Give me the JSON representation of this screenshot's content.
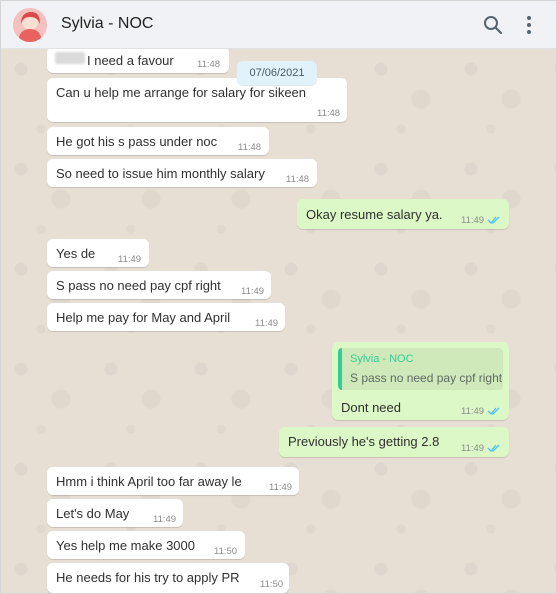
{
  "header": {
    "contact_name": "Sylvia - NOC",
    "search_icon": "search-icon",
    "menu_icon": "more-vert-icon"
  },
  "date_chip": "07/06/2021",
  "colors": {
    "incoming_bubble": "#ffffff",
    "outgoing_bubble": "#dcf8c6",
    "read_ticks": "#4fc3f7",
    "quote_accent": "#35cd96",
    "chat_background": "#e7ded4"
  },
  "messages": [
    {
      "dir": "in",
      "text": "I need a favour",
      "time": "11:48",
      "redacted_prefix": true
    },
    {
      "dir": "in",
      "text": "Can u help me arrange for salary for sikeen",
      "time": "11:48"
    },
    {
      "dir": "in",
      "text": "He got his s pass under noc",
      "time": "11:48"
    },
    {
      "dir": "in",
      "text": "So need to issue him monthly salary",
      "time": "11:48"
    },
    {
      "dir": "out",
      "text": "Okay resume salary ya.",
      "time": "11:49",
      "status": "read"
    },
    {
      "dir": "in",
      "text": "Yes de",
      "time": "11:49"
    },
    {
      "dir": "in",
      "text": "S pass no need pay cpf right",
      "time": "11:49"
    },
    {
      "dir": "in",
      "text": "Help me pay for May and April",
      "time": "11:49"
    },
    {
      "dir": "out",
      "text": "Dont need",
      "time": "11:49",
      "status": "read",
      "quote": {
        "author": "Sylvia - NOC",
        "text": "S pass no need pay cpf right"
      }
    },
    {
      "dir": "out",
      "text": "Previously he's getting 2.8",
      "time": "11:49",
      "status": "read"
    },
    {
      "dir": "in",
      "text": "Hmm i think April too far away le",
      "time": "11:49"
    },
    {
      "dir": "in",
      "text": "Let's do May",
      "time": "11:49"
    },
    {
      "dir": "in",
      "text": "Yes help me make 3000",
      "time": "11:50"
    },
    {
      "dir": "in",
      "text": "He needs for his try to apply PR",
      "time": "11:50"
    }
  ]
}
